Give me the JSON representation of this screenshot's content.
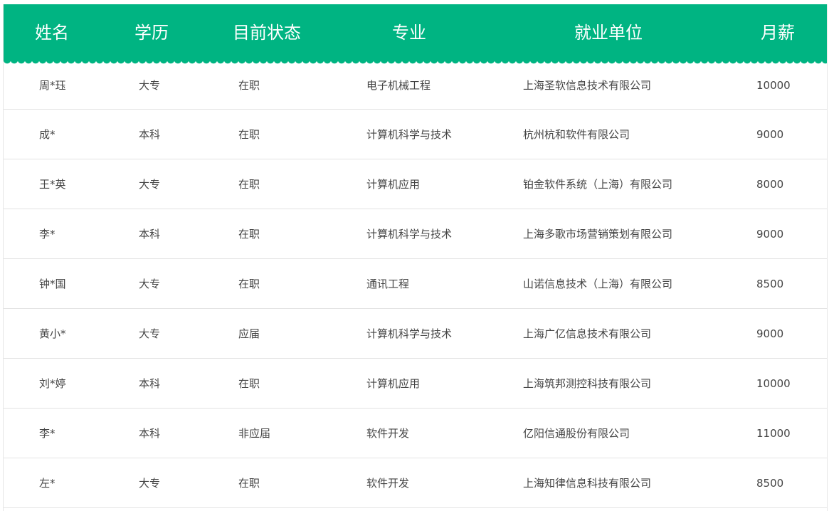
{
  "table": {
    "headers": [
      "姓名",
      "学历",
      "目前状态",
      "专业",
      "就业单位",
      "月薪"
    ],
    "rows": [
      [
        "周*珏",
        "大专",
        "在职",
        "电子机械工程",
        "上海圣软信息技术有限公司",
        "10000"
      ],
      [
        "成*",
        "本科",
        "在职",
        "计算机科学与技术",
        "杭州杭和软件有限公司",
        "9000"
      ],
      [
        "王*英",
        "大专",
        "在职",
        "计算机应用",
        "铂金软件系统（上海）有限公司",
        "8000"
      ],
      [
        "李*",
        "本科",
        "在职",
        "计算机科学与技术",
        "上海多歌市场营销策划有限公司",
        "9000"
      ],
      [
        "钟*国",
        "大专",
        "在职",
        "通讯工程",
        "山诺信息技术（上海）有限公司",
        "8500"
      ],
      [
        "黄小*",
        "大专",
        "应届",
        "计算机科学与技术",
        "上海广亿信息技术有限公司",
        "9000"
      ],
      [
        "刘*婷",
        "本科",
        "在职",
        "计算机应用",
        "上海筑邦测控科技有限公司",
        "10000"
      ],
      [
        "李*",
        "本科",
        "非应届",
        "软件开发",
        "亿阳信通股份有限公司",
        "11000"
      ],
      [
        "左*",
        "大专",
        "在职",
        "软件开发",
        "上海知律信息科技有限公司",
        "8500"
      ]
    ]
  },
  "colors": {
    "header_bg": "#00b482",
    "header_text": "#ffffff",
    "cell_text": "#444444",
    "divider": "#e3e3e3"
  }
}
